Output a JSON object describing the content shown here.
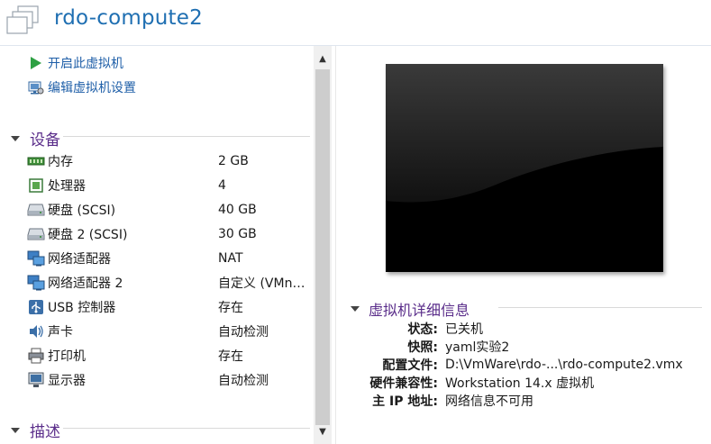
{
  "header": {
    "title": "rdo-compute2"
  },
  "actions": [
    {
      "label": "开启此虚拟机",
      "icon": "play-icon"
    },
    {
      "label": "编辑虚拟机设置",
      "icon": "edit-settings-icon"
    }
  ],
  "devices": {
    "title": "设备",
    "items": [
      {
        "name": "内存",
        "value": "2 GB",
        "icon": "memory-icon"
      },
      {
        "name": "处理器",
        "value": "4",
        "icon": "processor-icon"
      },
      {
        "name": "硬盘 (SCSI)",
        "value": "40 GB",
        "icon": "hard-disk-icon"
      },
      {
        "name": "硬盘 2 (SCSI)",
        "value": "30 GB",
        "icon": "hard-disk-icon"
      },
      {
        "name": "网络适配器",
        "value": "NAT",
        "icon": "network-adapter-icon"
      },
      {
        "name": "网络适配器 2",
        "value": "自定义 (VMn…",
        "icon": "network-adapter-icon"
      },
      {
        "name": "USB 控制器",
        "value": "存在",
        "icon": "usb-icon"
      },
      {
        "name": "声卡",
        "value": "自动检测",
        "icon": "sound-icon"
      },
      {
        "name": "打印机",
        "value": "存在",
        "icon": "printer-icon"
      },
      {
        "name": "显示器",
        "value": "自动检测",
        "icon": "display-icon"
      }
    ]
  },
  "description": {
    "title": "描述"
  },
  "details": {
    "title": "虚拟机详细信息",
    "rows": [
      {
        "label": "状态:",
        "value": "已关机"
      },
      {
        "label": "快照:",
        "value": "yaml实验2"
      },
      {
        "label": "配置文件:",
        "value": "D:\\VmWare\\rdo-...\\rdo-compute2.vmx"
      },
      {
        "label": "硬件兼容性:",
        "value": "Workstation 14.x 虚拟机"
      },
      {
        "label": "主 IP 地址:",
        "value": "网络信息不可用"
      }
    ]
  },
  "colors": {
    "title": "#1f6fb2",
    "section": "#5a2d8a",
    "link": "#1f5fa8",
    "play_green": "#2ea043"
  }
}
